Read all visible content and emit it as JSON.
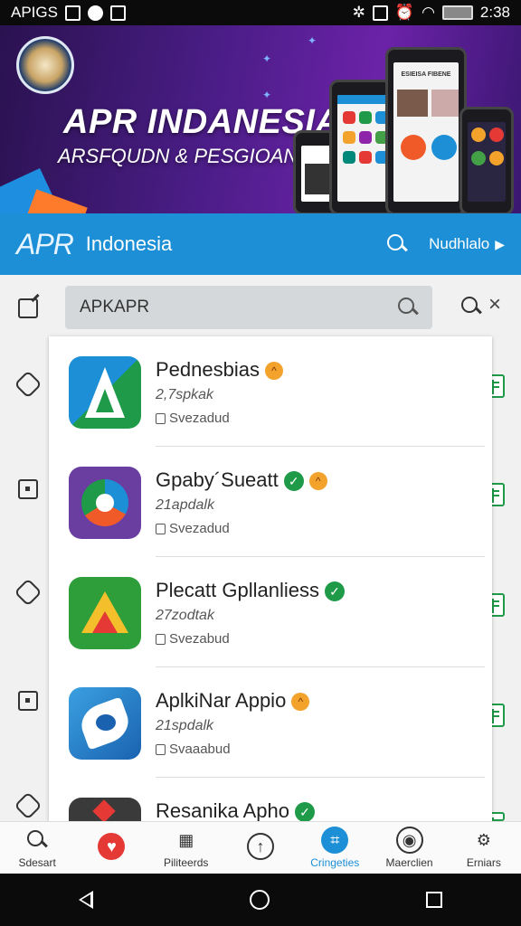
{
  "statusbar": {
    "carrier": "APIGS",
    "time": "2:38"
  },
  "banner": {
    "title": "APR INDANESIA",
    "subtitle": "ARSFQUDN & PESGIOAN",
    "phone_card_title": "ESIEISA FIBENE"
  },
  "appbar": {
    "brand": "APR",
    "country": "Indonesia",
    "menu_label": "Nudhlalo",
    "arrow": "▶"
  },
  "search": {
    "value": "APKAPR"
  },
  "apps": [
    {
      "name": "Pednesbias",
      "size": "2,7spkak",
      "status": "Svezadud",
      "verified": false,
      "hot": true
    },
    {
      "name": "Gpaby´Sueatt",
      "size": "21apdalk",
      "status": "Svezadud",
      "verified": true,
      "hot": true
    },
    {
      "name": "Plecatt Gpllanliess",
      "size": "27zodtak",
      "status": "Svezabud",
      "verified": true,
      "hot": false
    },
    {
      "name": "AplkiNar Appio",
      "size": "21spdalk",
      "status": "Svaaabud",
      "verified": false,
      "hot": true
    },
    {
      "name": "Resanika Apho",
      "size": "",
      "status": "",
      "verified": true,
      "hot": false
    }
  ],
  "bottom_nav": [
    {
      "label": "Sdesart",
      "icon": "search-icon"
    },
    {
      "label": "",
      "icon": "heart-icon"
    },
    {
      "label": "Piliteerds",
      "icon": "box-icon"
    },
    {
      "label": "",
      "icon": "compass-icon"
    },
    {
      "label": "Cringeties",
      "icon": "category-icon"
    },
    {
      "label": "Maerclien",
      "icon": "user-icon"
    },
    {
      "label": "Erniars",
      "icon": "gear-icon"
    }
  ],
  "colors": {
    "accent": "#1c8fd6",
    "verified": "#1e9a48",
    "hot": "#f3a22c",
    "banner": "#4a1d86"
  }
}
